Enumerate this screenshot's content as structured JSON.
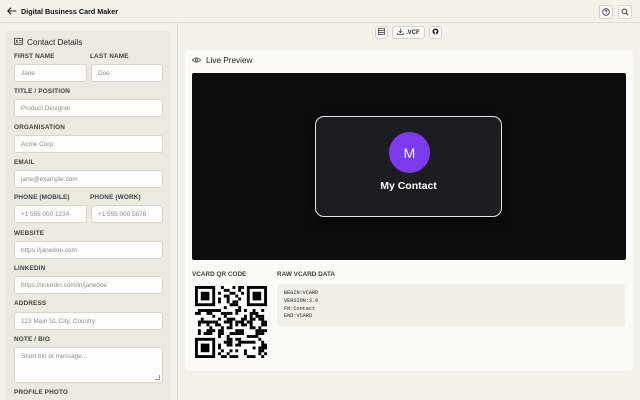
{
  "app": {
    "title": "Digital Business Card Maker"
  },
  "topbar": {
    "icons": [
      "back-arrow-icon",
      "help-icon",
      "search-icon"
    ]
  },
  "toolbar": {
    "buttons": [
      {
        "icon": "qr-grid-icon"
      },
      {
        "icon": "download-icon",
        "label": ".VCF"
      },
      {
        "icon": "github-icon"
      }
    ]
  },
  "form": {
    "heading": "Contact Details",
    "heading_icon": "contact-card-icon",
    "fields": {
      "first_name": {
        "label": "FIRST NAME",
        "placeholder": "Jane"
      },
      "last_name": {
        "label": "LAST NAME",
        "placeholder": "Doe"
      },
      "title": {
        "label": "TITLE / POSITION",
        "placeholder": "Product Designer"
      },
      "organisation": {
        "label": "ORGANISATION",
        "placeholder": "Acme Corp"
      },
      "email": {
        "label": "EMAIL",
        "placeholder": "jane@example.com"
      },
      "phone_mobile": {
        "label": "PHONE (MOBILE)",
        "placeholder": "+1 555 000 1234"
      },
      "phone_work": {
        "label": "PHONE (WORK)",
        "placeholder": "+1 555 000 5678"
      },
      "website": {
        "label": "WEBSITE",
        "placeholder": "https://janedoe.com"
      },
      "linkedin": {
        "label": "LINKEDIN",
        "placeholder": "https://linkedin.com/in/janedoe"
      },
      "address": {
        "label": "ADDRESS",
        "placeholder": "123 Main St, City, Country"
      },
      "bio": {
        "label": "NOTE / BIO",
        "placeholder": "Short bio or message..."
      },
      "photo": {
        "label": "PROFILE PHOTO"
      }
    }
  },
  "preview": {
    "heading": "Live Preview",
    "heading_icon": "eye-icon",
    "card": {
      "initial": "M",
      "name": "My Contact",
      "avatar_color": "#7c3aed"
    },
    "qr_label": "VCARD QR CODE",
    "raw_label": "RAW VCARD DATA",
    "raw_lines": [
      "BEGIN:VCARD",
      "VERSION:3.0",
      "FN:Contact",
      "END:VCARD"
    ]
  }
}
